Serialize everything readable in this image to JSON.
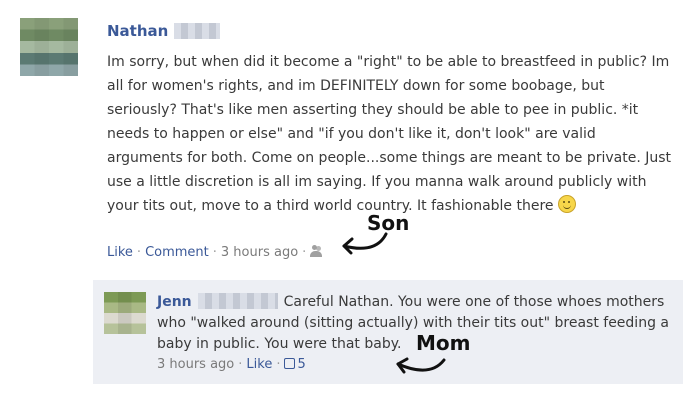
{
  "post": {
    "author_name": "Nathan",
    "text_before_emoji": "Im sorry, but when did it become a \"right\" to be able to breastfeed in public? Im all for women's rights, and im DEFINITELY down for some boobage, but seriously? That's like men asserting they should be able to pee in public. *it needs to happen or else\" and \"if you don't like it, don't look\" are valid arguments for both. Come on people...some things are meant to be private. Just use a little discretion is all im saying. If you manna walk around publicly with your tits out, move to a third world country. It fashionable there",
    "emoji_icon": "smiley-icon",
    "like_label": "Like",
    "comment_label": "Comment",
    "timestamp": "3 hours ago",
    "audience_icon": "friends-icon"
  },
  "comment": {
    "author_name": "Jenn",
    "text": "Careful Nathan. You were one of those whoes mothers who \"walked around (sitting actually) with their tits out\" breast feeding a baby in public. You were that baby.",
    "timestamp": "3 hours ago",
    "like_label": "Like",
    "like_icon": "thumbs-up-icon",
    "like_count": "5"
  },
  "annotations": {
    "son_label": "Son",
    "mom_label": "Mom"
  },
  "colors": {
    "link": "#3b5998",
    "reply_bg": "#edeff4",
    "meta": "#7a7a7a"
  }
}
